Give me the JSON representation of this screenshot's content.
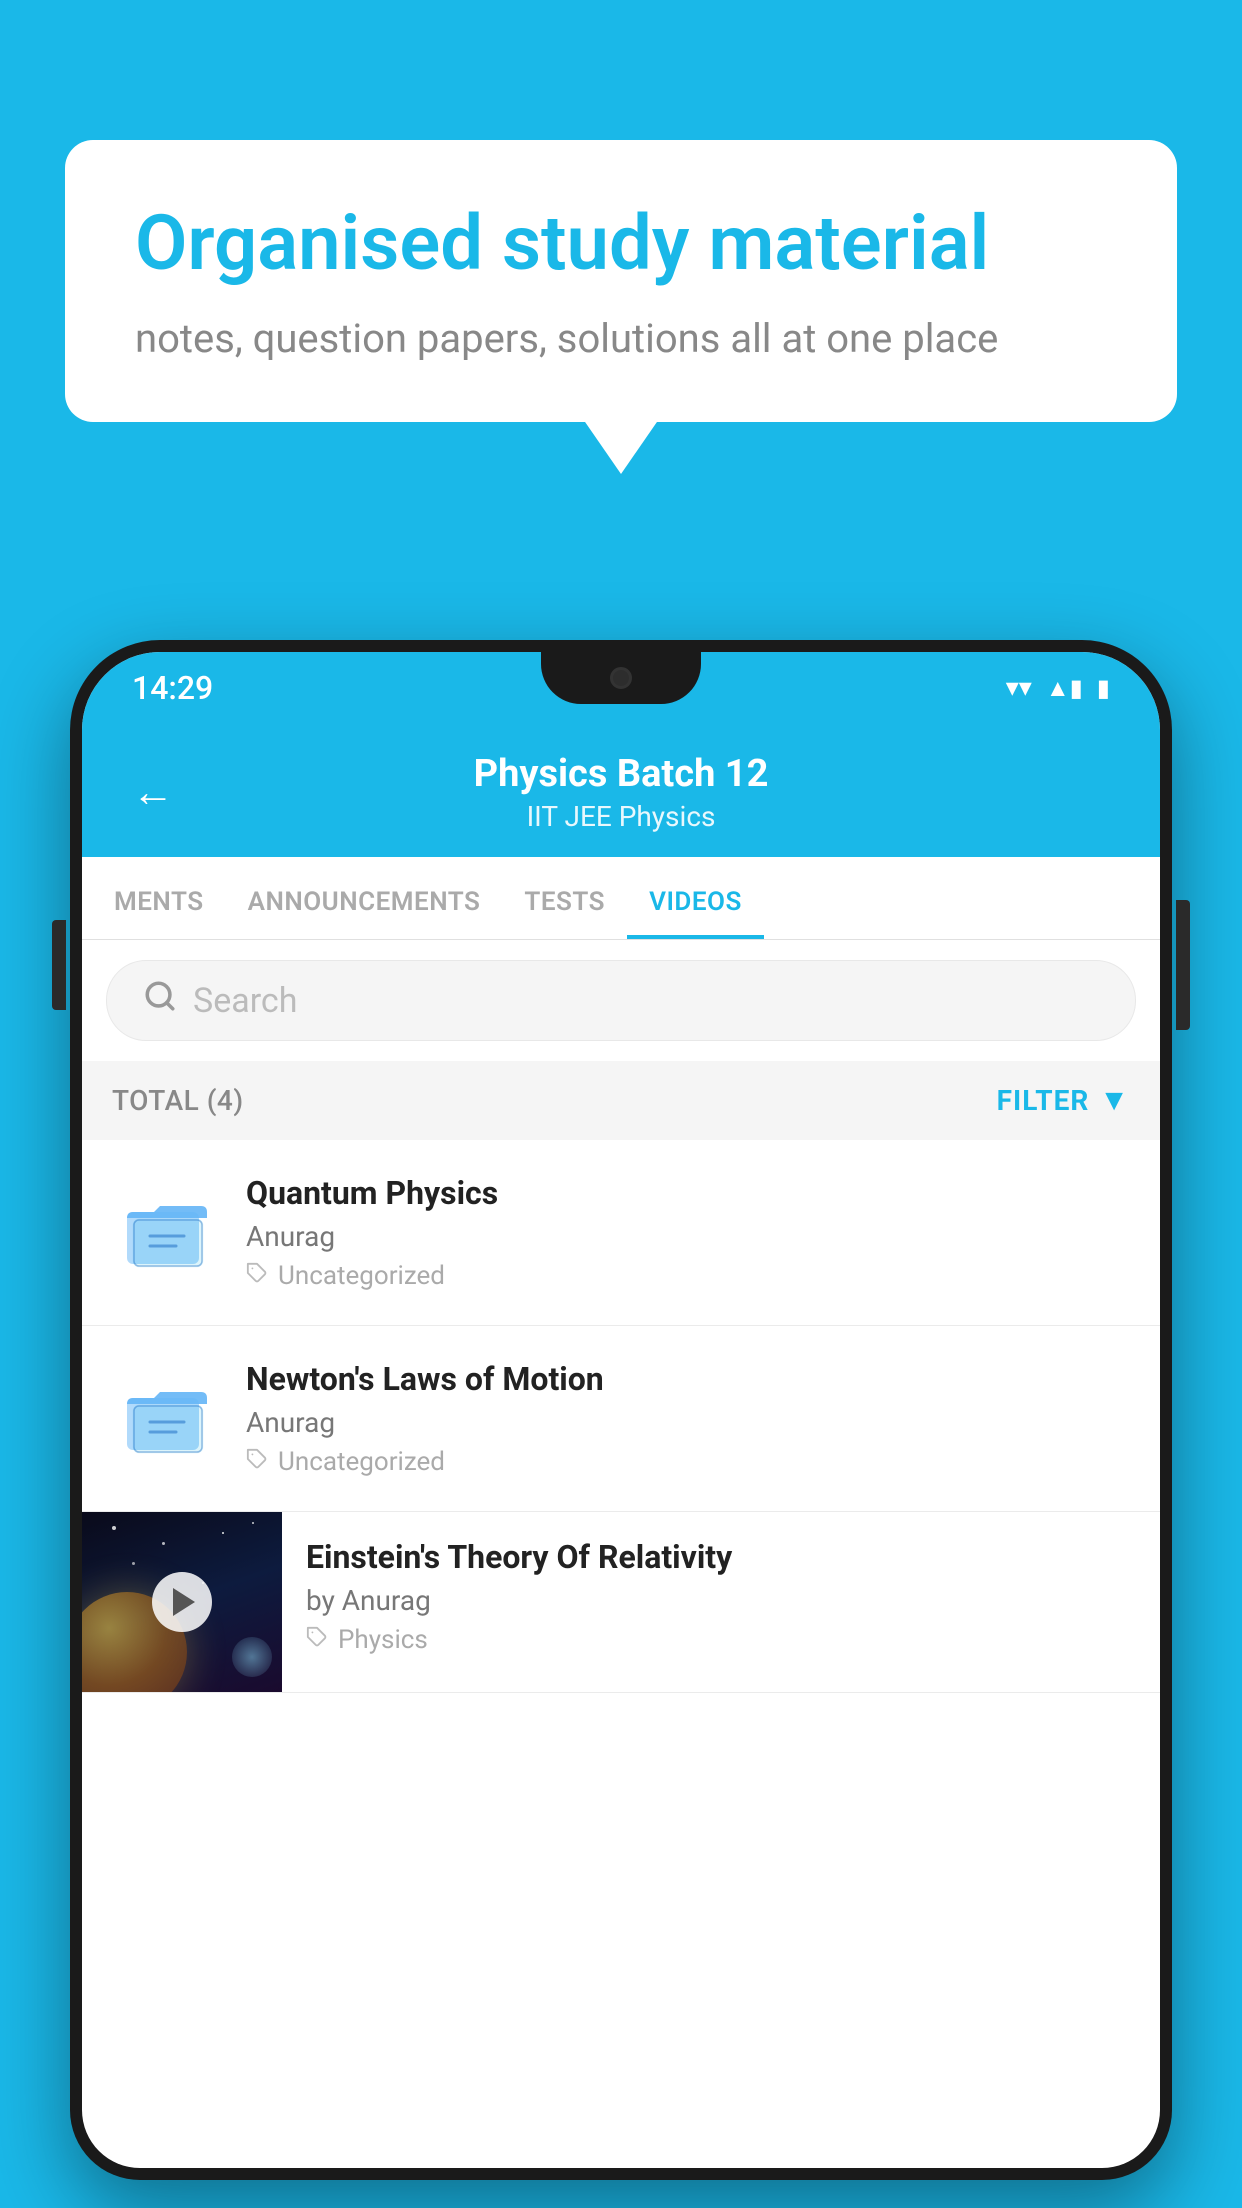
{
  "background_color": "#1ab8e8",
  "hero": {
    "title": "Organised study material",
    "subtitle": "notes, question papers, solutions all at one place"
  },
  "phone": {
    "status_bar": {
      "time": "14:29",
      "wifi": "▾",
      "signal": "▲",
      "battery": "▮"
    },
    "header": {
      "title": "Physics Batch 12",
      "subtitle_tags": "IIT JEE    Physics",
      "back_label": "←"
    },
    "tabs": [
      {
        "label": "MENTS",
        "active": false
      },
      {
        "label": "ANNOUNCEMENTS",
        "active": false
      },
      {
        "label": "TESTS",
        "active": false
      },
      {
        "label": "VIDEOS",
        "active": true
      }
    ],
    "search": {
      "placeholder": "Search"
    },
    "filter_row": {
      "total_label": "TOTAL (4)",
      "filter_label": "FILTER"
    },
    "videos": [
      {
        "id": 1,
        "title": "Quantum Physics",
        "author": "Anurag",
        "tag": "Uncategorized",
        "type": "folder"
      },
      {
        "id": 2,
        "title": "Newton's Laws of Motion",
        "author": "Anurag",
        "tag": "Uncategorized",
        "type": "folder"
      },
      {
        "id": 3,
        "title": "Einstein's Theory Of Relativity",
        "author": "by Anurag",
        "tag": "Physics",
        "type": "video"
      }
    ]
  }
}
